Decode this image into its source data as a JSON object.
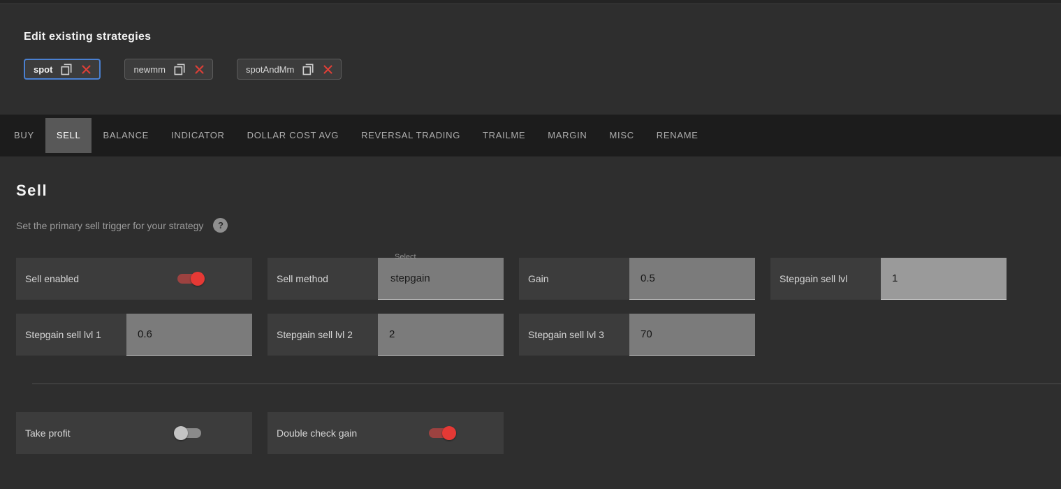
{
  "strategies_section": {
    "heading": "Edit existing strategies",
    "items": [
      {
        "name": "spot",
        "selected": true
      },
      {
        "name": "newmm",
        "selected": false
      },
      {
        "name": "spotAndMm",
        "selected": false
      }
    ]
  },
  "nav": {
    "tabs": [
      {
        "label": "BUY",
        "active": false
      },
      {
        "label": "SELL",
        "active": true
      },
      {
        "label": "BALANCE",
        "active": false
      },
      {
        "label": "INDICATOR",
        "active": false
      },
      {
        "label": "DOLLAR COST AVG",
        "active": false
      },
      {
        "label": "REVERSAL TRADING",
        "active": false
      },
      {
        "label": "TRAILME",
        "active": false
      },
      {
        "label": "MARGIN",
        "active": false
      },
      {
        "label": "MISC",
        "active": false
      },
      {
        "label": "RENAME",
        "active": false
      }
    ]
  },
  "sell_page": {
    "title": "Sell",
    "subtitle": "Set the primary sell trigger for your strategy",
    "fields": {
      "sell_enabled": {
        "label": "Sell enabled",
        "type": "toggle",
        "value": "on"
      },
      "sell_method": {
        "label": "Sell method",
        "type": "select",
        "floating_label": "Select",
        "value": "stepgain"
      },
      "gain": {
        "label": "Gain",
        "type": "input",
        "value": "0.5"
      },
      "stepgain_sell_lvl": {
        "label": "Stepgain sell lvl",
        "type": "input",
        "value": "1"
      },
      "stepgain_sell_lvl_1": {
        "label": "Stepgain sell lvl 1",
        "type": "input",
        "value": "0.6"
      },
      "stepgain_sell_lvl_2": {
        "label": "Stepgain sell lvl 2",
        "type": "input",
        "value": "2"
      },
      "stepgain_sell_lvl_3": {
        "label": "Stepgain sell lvl 3",
        "type": "input",
        "value": "70"
      },
      "take_profit": {
        "label": "Take profit",
        "type": "toggle",
        "value": "off"
      },
      "double_check_gain": {
        "label": "Double check gain",
        "type": "toggle",
        "value": "on"
      }
    }
  },
  "icons": {
    "help_glyph": "?"
  },
  "colors": {
    "toggle_on": "#e53935",
    "delete_icon": "#dd3f37",
    "selected_chip_border": "#4a80d1",
    "active_tab_bg": "#585858"
  }
}
